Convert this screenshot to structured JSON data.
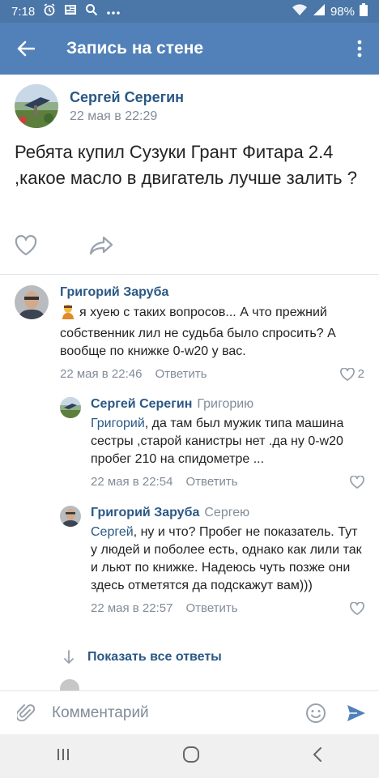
{
  "status_bar": {
    "time": "7:18",
    "battery": "98%"
  },
  "app_bar": {
    "title": "Запись на стене"
  },
  "post": {
    "author": "Сергей Серегин",
    "date": "22 мая в 22:29",
    "text": "Ребята купил Сузуки Грант Фитара 2.4 ,какое масло в двигатель лучше залить ?"
  },
  "comments": [
    {
      "author": "Григорий Заруба",
      "text": "я хуею с таких вопросов... А что прежний собственник лил не судьба было спросить? А вообще по книжке 0-w20 у вас.",
      "date": "22 мая в 22:46",
      "reply_label": "Ответить",
      "likes": "2"
    },
    {
      "author": "Сергей Серегин",
      "reply_to": "Григорию",
      "mention": "Григорий",
      "text": ", да там был мужик типа машина сестры ,старой канистры нет .да ну 0-w20 пробег 210 на спидометре ...",
      "date": "22 мая в 22:54",
      "reply_label": "Ответить"
    },
    {
      "author": "Григорий Заруба",
      "reply_to": "Сергею",
      "mention": "Сергей",
      "text": ", ну и что? Пробег не показатель. Тут у людей и поболее есть, однако как лили так и льют по книжке. Надеюсь чуть позже они здесь отметятся да подскажут вам)))",
      "date": "22 мая в 22:57",
      "reply_label": "Ответить"
    }
  ],
  "show_all_replies": "Показать все ответы",
  "comment_input": {
    "placeholder": "Комментарий"
  },
  "colors": {
    "accent": "#5181b8",
    "link": "#2a5885",
    "meta": "#818c99"
  }
}
